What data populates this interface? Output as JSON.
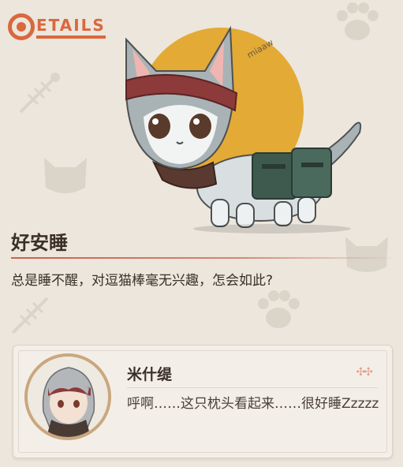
{
  "header": {
    "logo_text": "ETAILS"
  },
  "item": {
    "name": "好安睡",
    "description": "总是睡不醒，对逗猫棒毫无兴趣，怎会如此?",
    "signature": "miaaw"
  },
  "dialogue": {
    "speaker": "米什缇",
    "text": "呼啊……这只枕头看起来……很好睡Zzzzz"
  },
  "colors": {
    "accent": "#d9683e",
    "sun": "#e3aa36",
    "background": "#ece6dc"
  }
}
